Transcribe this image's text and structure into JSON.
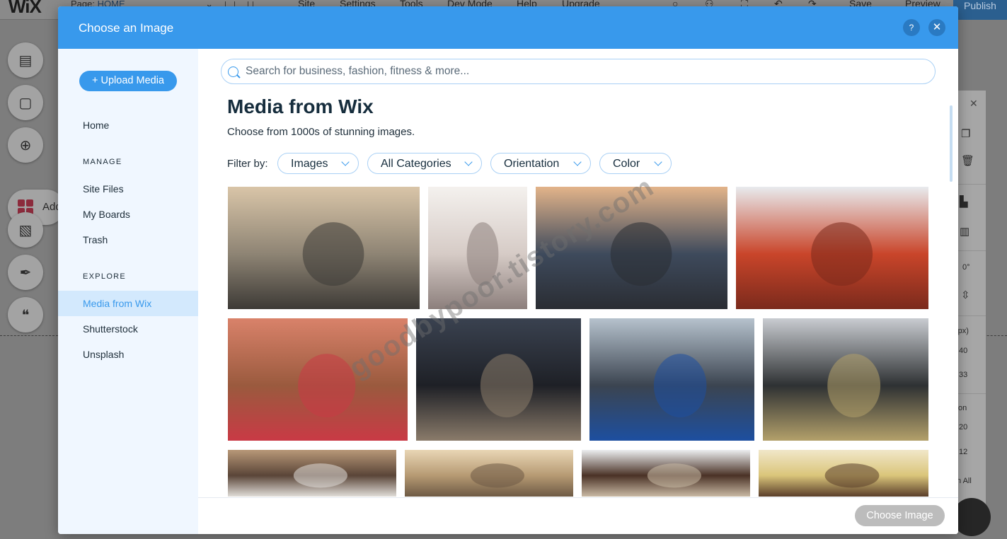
{
  "editor": {
    "logo": "WiX",
    "page_label": "Page:",
    "page_value": "HOME",
    "menu": [
      "Site",
      "Settings",
      "Tools",
      "Dev Mode",
      "Help",
      "Upgrade"
    ],
    "save": "Save",
    "preview": "Preview",
    "publish": "Publish",
    "add_label": "Add",
    "right_panel": [
      "0°",
      "(px)",
      "40",
      "33",
      "on",
      "20",
      "12",
      "n All"
    ]
  },
  "modal": {
    "title": "Choose an Image",
    "help": "?",
    "close": "✕"
  },
  "sidebar": {
    "upload": "+ Upload Media",
    "home": "Home",
    "manage_heading": "MANAGE",
    "manage": [
      "Site Files",
      "My Boards",
      "Trash"
    ],
    "explore_heading": "EXPLORE",
    "explore": [
      "Media from Wix",
      "Shutterstock",
      "Unsplash"
    ]
  },
  "main": {
    "search_placeholder": "Search for business, fashion, fitness & more...",
    "heading": "Media from Wix",
    "subheading": "Choose from 1000s of stunning images.",
    "filter_label": "Filter by:",
    "filters": [
      "Images",
      "All Categories",
      "Orientation",
      "Color"
    ]
  },
  "images": [
    {
      "name": "kids-jumping-sea",
      "colors": [
        "#d9c5a8",
        "#8e8474",
        "#3d3a36"
      ]
    },
    {
      "name": "couple-sunlight",
      "colors": [
        "#f4f1ee",
        "#d6cbc6",
        "#8c7f7c"
      ]
    },
    {
      "name": "people-watching-sea",
      "colors": [
        "#e3b48a",
        "#3e4a5c",
        "#2a2d33"
      ]
    },
    {
      "name": "basketball-player",
      "colors": [
        "#e8ebee",
        "#c9452a",
        "#7b2a1c"
      ]
    },
    {
      "name": "heart-hands",
      "colors": [
        "#d9826a",
        "#9a5a3e",
        "#c93a45"
      ]
    },
    {
      "name": "wedding-couple-window",
      "colors": [
        "#3a4250",
        "#1e2026",
        "#8a7b6a"
      ]
    },
    {
      "name": "bar-workout-man",
      "colors": [
        "#b6c2cd",
        "#3b4450",
        "#1d4fa0"
      ]
    },
    {
      "name": "rocky-shore-man",
      "colors": [
        "#c9ccd1",
        "#2e3133",
        "#b3a06a"
      ]
    },
    {
      "name": "cafe-interior",
      "colors": [
        "#b89878",
        "#5a4538",
        "#e0ddd8"
      ]
    },
    {
      "name": "hill-silhouette",
      "colors": [
        "#e9d6b5",
        "#b69a73",
        "#6e5a45"
      ]
    },
    {
      "name": "afro-woman-window",
      "colors": [
        "#eceef0",
        "#4a3226",
        "#c9b9a4"
      ]
    },
    {
      "name": "child-playing",
      "colors": [
        "#f1e7c9",
        "#dac57a",
        "#5a3e2a"
      ]
    }
  ],
  "footer": {
    "choose_button": "Choose Image"
  },
  "watermark": "goodbypoor.tistory.com"
}
